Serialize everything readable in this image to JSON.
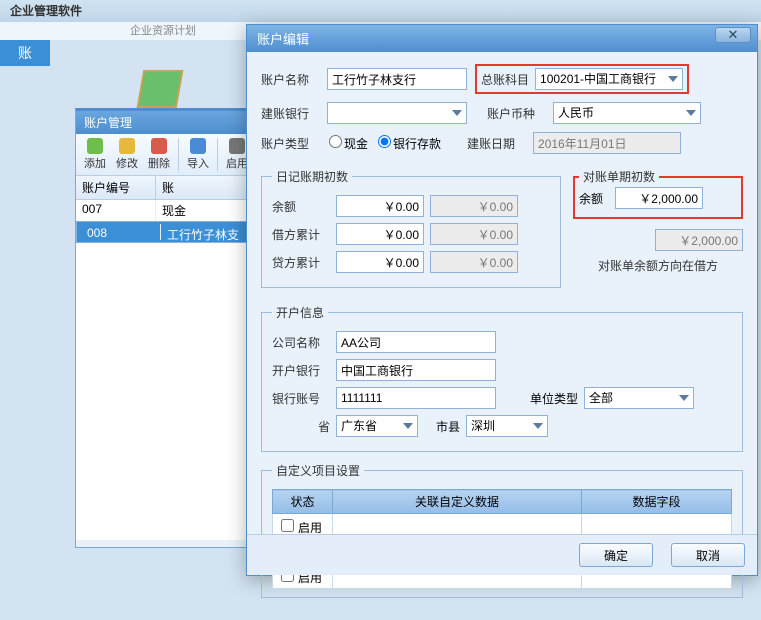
{
  "app": {
    "title": "企业管理软件",
    "subtitle": "企业资源计划"
  },
  "sidebar_tab": "账",
  "manage": {
    "title": "账户管理",
    "toolbar": {
      "add": "添加",
      "edit": "修改",
      "del": "删除",
      "imp": "导入",
      "enable": "启用"
    },
    "cols": {
      "num": "账户编号",
      "name": "账"
    },
    "rows": [
      {
        "num": "007",
        "name": "现金"
      },
      {
        "num": "008",
        "name": "工行竹子林支"
      }
    ]
  },
  "dialog": {
    "title": "账户编辑",
    "labels": {
      "acct_name": "账户名称",
      "gl": "总账科目",
      "bank": "建账银行",
      "currency": "账户币种",
      "acct_type": "账户类型",
      "date": "建账日期",
      "cash": "现金",
      "deposit": "银行存款",
      "journal_init": "日记账期初数",
      "balance": "余额",
      "debit": "借方累计",
      "credit": "贷方累计",
      "recon_init": "对账单期初数",
      "recon_note": "对账单余额方向在借方",
      "open_info": "开户信息",
      "company": "公司名称",
      "open_bank": "开户银行",
      "bank_no": "银行账号",
      "province": "省",
      "city": "市县",
      "unit_type": "单位类型",
      "custom": "自定义项目设置",
      "status": "状态",
      "rel": "关联自定义数据",
      "field": "数据字段",
      "enable": "启用",
      "ok": "确定",
      "cancel": "取消"
    },
    "values": {
      "acct_name": "工行竹子林支行",
      "gl": "100201-中国工商银行",
      "bank": "",
      "currency": "人民币",
      "date": "2016年11月01日",
      "journal_balance": "￥0.00",
      "journal_balance_ro": "￥0.00",
      "debit": "￥0.00",
      "debit_ro": "￥0.00",
      "credit": "￥0.00",
      "credit_ro": "￥0.00",
      "recon_balance": "￥2,000.00",
      "recon_balance_ro": "￥2,000.00",
      "company": "AA公司",
      "open_bank": "中国工商银行",
      "bank_no": "1111111",
      "province": "广东省",
      "city": "深圳",
      "unit_type": "全部"
    }
  }
}
